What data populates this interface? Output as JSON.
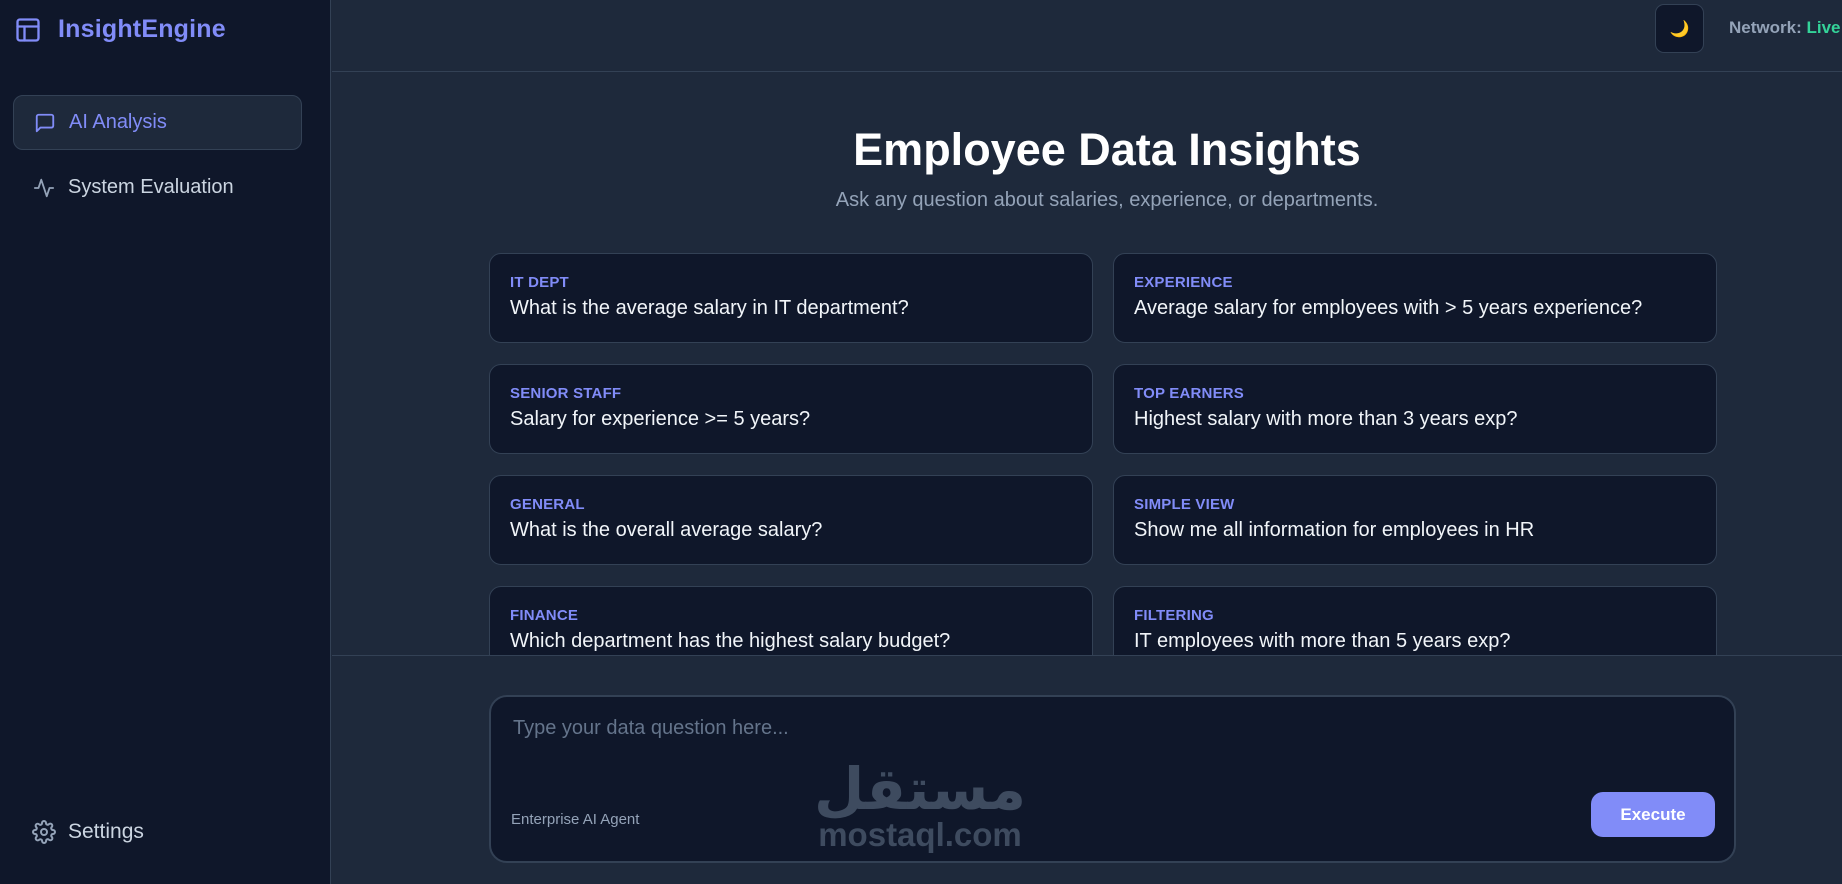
{
  "brand": {
    "name": "InsightEngine"
  },
  "nav": {
    "items": [
      {
        "label": "AI Analysis",
        "active": true,
        "icon": "message-square-icon"
      },
      {
        "label": "System Evaluation",
        "active": false,
        "icon": "activity-icon"
      }
    ],
    "settings_label": "Settings"
  },
  "topbar": {
    "theme_icon": "🌙",
    "network_label": "Network:",
    "network_status": "Live"
  },
  "main": {
    "title": "Employee Data Insights",
    "subtitle": "Ask any question about salaries, experience, or departments.",
    "cards": [
      {
        "category": "IT DEPT",
        "question": "What is the average salary in IT department?"
      },
      {
        "category": "EXPERIENCE",
        "question": "Average salary for employees with > 5 years experience?"
      },
      {
        "category": "SENIOR STAFF",
        "question": "Salary for experience >= 5 years?"
      },
      {
        "category": "TOP EARNERS",
        "question": "Highest salary with more than 3 years exp?"
      },
      {
        "category": "GENERAL",
        "question": "What is the overall average salary?"
      },
      {
        "category": "SIMPLE VIEW",
        "question": "Show me all information for employees in HR"
      },
      {
        "category": "FINANCE",
        "question": "Which department has the highest salary budget?"
      },
      {
        "category": "FILTERING",
        "question": "IT employees with more than 5 years exp?"
      }
    ]
  },
  "composer": {
    "placeholder": "Type your data question here...",
    "value": "",
    "agent_label": "Enterprise AI Agent",
    "execute_label": "Execute"
  },
  "watermark": {
    "arabic": "مستقل",
    "latin": "mostaql.com"
  },
  "colors": {
    "accent": "#818cf8",
    "sidebar_bg": "#0f172a",
    "main_bg": "#1e293b",
    "live": "#34d399"
  }
}
